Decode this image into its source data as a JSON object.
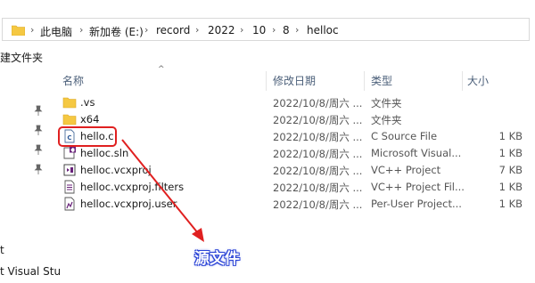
{
  "address_bar": {
    "crumbs": [
      "此电脑",
      "新加卷 (E:)",
      "record",
      "2022",
      "10",
      "8",
      "helloc"
    ]
  },
  "nav": {
    "new_folder": "建文件夹",
    "t_item": "t",
    "vs_item": "t Visual Stu"
  },
  "columns": {
    "name": "名称",
    "date": "修改日期",
    "type": "类型",
    "size": "大小"
  },
  "files": [
    {
      "name": ".vs",
      "date": "2022/10/8/周六 ...",
      "type": "文件夹",
      "size": "",
      "icon": "folder-icon"
    },
    {
      "name": "x64",
      "date": "2022/10/8/周六 ...",
      "type": "文件夹",
      "size": "",
      "icon": "folder-icon"
    },
    {
      "name": "hello.c",
      "date": "2022/10/8/周六 ...",
      "type": "C Source File",
      "size": "1 KB",
      "icon": "c-source-file-icon"
    },
    {
      "name": "helloc.sln",
      "date": "2022/10/8/周六 ...",
      "type": "Microsoft Visual...",
      "size": "1 KB",
      "icon": "solution-file-icon"
    },
    {
      "name": "helloc.vcxproj",
      "date": "2022/10/8/周六 ...",
      "type": "VC++ Project",
      "size": "7 KB",
      "icon": "vcxproj-file-icon"
    },
    {
      "name": "helloc.vcxproj.filters",
      "date": "2022/10/8/周六 ...",
      "type": "VC++ Project Fil...",
      "size": "1 KB",
      "icon": "filters-file-icon"
    },
    {
      "name": "helloc.vcxproj.user",
      "date": "2022/10/8/周六 ...",
      "type": "Per-User Project...",
      "size": "1 KB",
      "icon": "user-file-icon"
    }
  ],
  "annotation": {
    "label": "源文件",
    "color": "#e02020"
  },
  "colors": {
    "folder": "#f5c842",
    "annotation_red": "#e02020",
    "label_blue": "#2a43d6"
  }
}
